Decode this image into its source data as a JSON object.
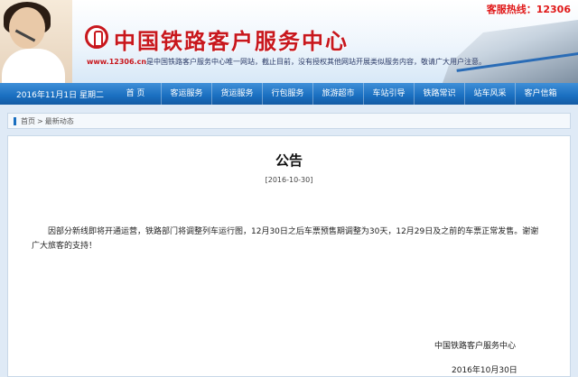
{
  "header": {
    "hotline": "客服热线：12306",
    "site_title": "中国铁路客户服务中心",
    "url": "www.12306.cn",
    "notice": "是中国铁路客户服务中心唯一网站，截止目前，没有授权其他网站开展类似服务内容，敬请广大用户注意。"
  },
  "nav": {
    "date": "2016年11月1日 星期二",
    "items": [
      "首 页",
      "客运服务",
      "货运服务",
      "行包服务",
      "旅游超市",
      "车站引导",
      "铁路常识",
      "站车风采",
      "客户信箱"
    ]
  },
  "breadcrumb": {
    "home": "首页",
    "separator": ">",
    "current": "最新动态"
  },
  "article": {
    "title": "公告",
    "date": "[2016-10-30]",
    "body": "因部分新线即将开通运营，铁路部门将调整列车运行图，12月30日之后车票预售期调整为30天，12月29日及之前的车票正常发售。谢谢广大旅客的支持！",
    "signature_org": "中国铁路客户服务中心",
    "signature_date": "2016年10月30日"
  },
  "colors": {
    "nav_blue": "#1a6fc0",
    "brand_red": "#c8171d"
  }
}
